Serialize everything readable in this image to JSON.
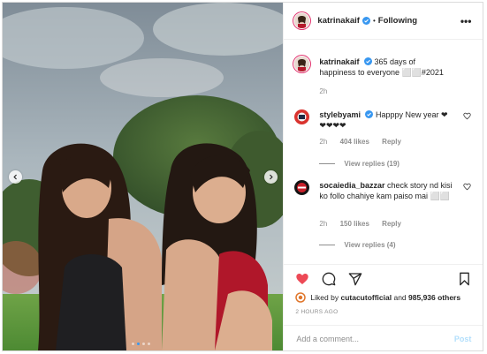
{
  "header": {
    "username": "katrinakaif",
    "separator": "•",
    "follow_status": "Following",
    "more_icon": "more-horizontal-icon",
    "more_label": "•••"
  },
  "photo": {
    "description_icon": "carousel-photo",
    "prev_icon": "chevron-left-icon",
    "next_icon": "chevron-right-icon",
    "carousel_dots": 4,
    "active_dot": 2
  },
  "caption": {
    "username": "katrinakaif",
    "text": "365 days of happiness to everyone ⬜⬜#2021",
    "time": "2h"
  },
  "comments": [
    {
      "username": "stylebyami",
      "text": "Happpy New year ❤❤❤❤❤",
      "time": "2h",
      "likes": "404 likes",
      "reply": "Reply",
      "view_replies": "View replies (19)"
    },
    {
      "username": "socaiedia_bazzar",
      "text": "check story nd kisi ko follo chahiye kam paiso mai ⬜⬜",
      "time": "2h",
      "likes": "150 likes",
      "reply": "Reply",
      "view_replies": "View replies (4)"
    }
  ],
  "actions": {
    "like_icon": "heart-icon",
    "comment_icon": "comment-icon",
    "share_icon": "share-icon",
    "save_icon": "bookmark-icon",
    "liked_by_prefix": "Liked by",
    "liked_by_user": "cutacutofficial",
    "liked_by_and": "and",
    "liked_by_count": "985,936 others",
    "time_ago": "2 HOURS AGO"
  },
  "add_comment": {
    "placeholder": "Add a comment...",
    "post_label": "Post"
  },
  "colors": {
    "like_red": "#ed4956",
    "verified_blue": "#3897f0",
    "muted_gray": "#8e8e8e",
    "post_button_disabled": "#b2dffc"
  }
}
